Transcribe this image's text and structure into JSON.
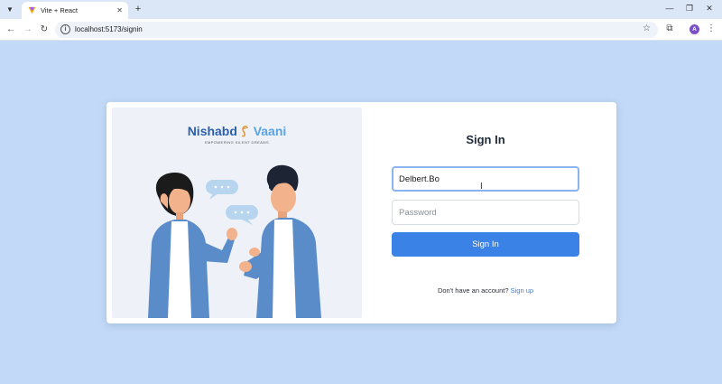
{
  "browser": {
    "tab_title": "Vite + React",
    "tab_close": "✕",
    "new_tab": "+",
    "url": "localhost:5173/signin",
    "icons": [
      "tab-list-icon",
      "vite-logo-icon",
      "close-icon",
      "plus-icon",
      "minimize-icon",
      "restore-icon",
      "close-window-icon",
      "back-icon",
      "forward-icon",
      "reload-icon",
      "info-icon",
      "star-icon",
      "extensions-icon",
      "kebab-menu-icon"
    ],
    "avatar_letter": "A",
    "controls": {
      "minimize": "—",
      "restore": "❐",
      "close": "✕"
    },
    "nav": {
      "back": "←",
      "forward": "→",
      "reload": "↻"
    }
  },
  "brand": {
    "part1": "Nishabd",
    "part2": "Vaani",
    "tagline": "EMPOWERING SILENT DREAMS"
  },
  "signin": {
    "title": "Sign In",
    "username_value": "Delbert.Bo",
    "password_placeholder": "Password",
    "submit_label": "Sign In",
    "no_account_text": "Don't have an account?",
    "signup_link": "Sign up"
  },
  "colors": {
    "page_bg": "#c2daf7",
    "accent": "#3b82e6",
    "brand_dark": "#2a5fb0",
    "brand_light": "#5ba2e0"
  }
}
